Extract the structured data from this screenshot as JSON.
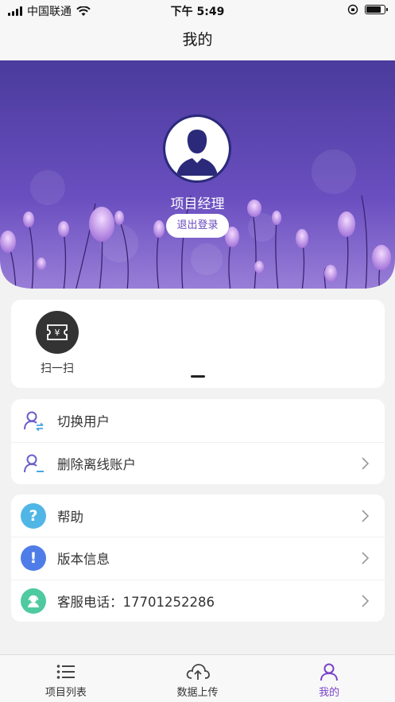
{
  "status_bar": {
    "carrier": "中国联通",
    "time": "下午 5:49"
  },
  "nav": {
    "title": "我的"
  },
  "profile": {
    "username": "项目经理",
    "logout_label": "退出登录"
  },
  "quick_actions": {
    "scan_label": "扫一扫",
    "scan_glyph": "¥"
  },
  "account_menu": {
    "switch_user": "切换用户",
    "delete_offline": "删除离线账户"
  },
  "info_menu": {
    "help": "帮助",
    "help_glyph": "?",
    "version": "版本信息",
    "version_glyph": "!",
    "service": "客服电话：17701252286"
  },
  "tab_bar": {
    "tabs": [
      {
        "label": "项目列表",
        "icon": "list-icon"
      },
      {
        "label": "数据上传",
        "icon": "cloud-upload-icon"
      },
      {
        "label": "我的",
        "icon": "person-icon"
      }
    ],
    "active_index": 2
  },
  "colors": {
    "accent": "#7a43c9",
    "hero_top": "#4a3b9c",
    "help_icon": "#4fb6e6",
    "version_icon": "#4f7de8",
    "service_icon": "#4ec9a0"
  }
}
